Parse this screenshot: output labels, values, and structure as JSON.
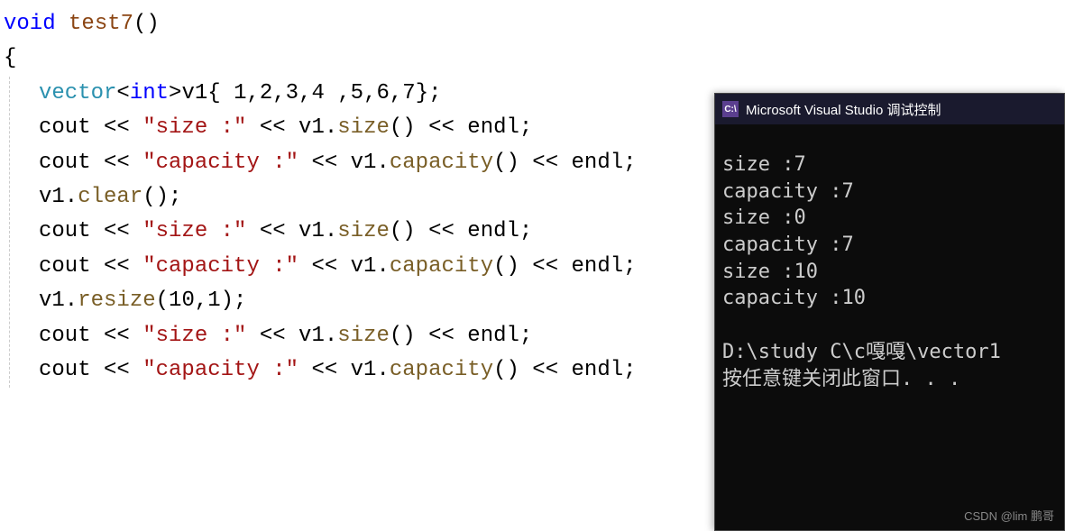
{
  "code": {
    "line1_void": "void",
    "line1_space": " ",
    "line1_fn": "test7",
    "line1_paren": "()",
    "line2": "{",
    "line3_vector": "vector",
    "line3_lt": "<",
    "line3_int": "int",
    "line3_gt": ">",
    "line3_v1": "v1{ ",
    "line3_nums": "1,2,3,4 ,5,6,7",
    "line3_end": "};",
    "line4_cout": "cout << ",
    "line4_str": "\"size :\"",
    "line4_mid": " << v1.",
    "line4_size": "size",
    "line4_end": "() << endl;",
    "line5_cout": "cout << ",
    "line5_str": "\"capacity :\"",
    "line5_mid": " << v1.",
    "line5_cap": "capacity",
    "line5_end": "() << endl;",
    "line6_v1": "v1.",
    "line6_clear": "clear",
    "line6_end": "();",
    "line7_cout": "cout << ",
    "line7_str": "\"size :\"",
    "line7_mid": " << v1.",
    "line7_size": "size",
    "line7_end": "() << endl;",
    "line8_cout": "cout << ",
    "line8_str": "\"capacity :\"",
    "line8_mid": " << v1.",
    "line8_cap": "capacity",
    "line8_end": "() << endl;",
    "line9": "",
    "line10_v1": "v1.",
    "line10_resize": "resize",
    "line10_paren": "(",
    "line10_nums": "10,1",
    "line10_end": ");",
    "line11_cout": "cout << ",
    "line11_str": "\"size :\"",
    "line11_mid": " << v1.",
    "line11_size": "size",
    "line11_end": "() << endl;",
    "line12_cout": "cout << ",
    "line12_str": "\"capacity :\"",
    "line12_mid": " << v1.",
    "line12_cap": "capacity",
    "line12_end": "() << endl;"
  },
  "console": {
    "icon_text": "C:\\",
    "title": "Microsoft Visual Studio 调试控制",
    "output": "size :7\ncapacity :7\nsize :0\ncapacity :7\nsize :10\ncapacity :10\n\nD:\\study C\\c嘎嘎\\vector1\n按任意键关闭此窗口. . ."
  },
  "watermark": "CSDN @lim 鹏哥"
}
